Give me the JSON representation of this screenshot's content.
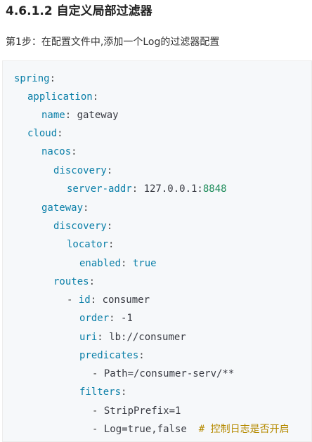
{
  "heading": "4.6.1.2 自定义局部过滤器",
  "step": "第1步：在配置文件中,添加一个Log的过滤器配置",
  "code": {
    "spring_key": "spring",
    "application_key": "application",
    "name_key": "name",
    "name_value": "gateway",
    "cloud_key": "cloud",
    "nacos_key": "nacos",
    "discovery_key": "discovery",
    "server_addr_key": "server-addr",
    "server_addr_host": "127.0.0.1:",
    "server_addr_port": "8848",
    "gateway_key": "gateway",
    "gateway_discovery_key": "discovery",
    "locator_key": "locator",
    "enabled_key": "enabled",
    "enabled_value": "true",
    "routes_key": "routes",
    "id_key": "id",
    "id_value": "consumer",
    "order_key": "order",
    "order_value": "-1",
    "uri_key": "uri",
    "uri_value": "lb://consumer",
    "predicates_key": "predicates",
    "predicate_item": "Path=/consumer-serv/**",
    "filters_key": "filters",
    "filter_item_1": "StripPrefix=1",
    "filter_item_2": "Log=true,false",
    "filter_comment": "# 控制日志是否开启"
  },
  "colors": {
    "key": "#0a7fa8",
    "number": "#1e8c5a",
    "comment": "#b58a00",
    "code_background": "#f6f8fa"
  }
}
